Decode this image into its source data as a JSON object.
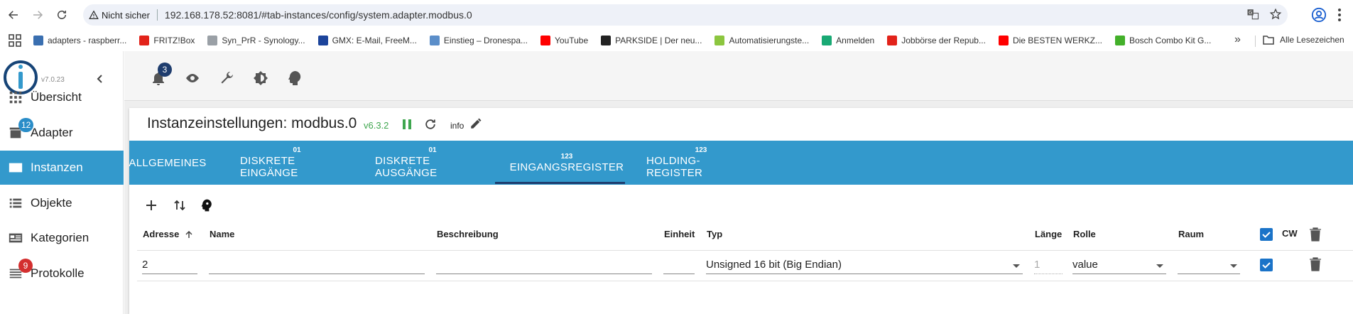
{
  "browser": {
    "security_label": "Nicht sicher",
    "url": "192.168.178.52:8081/#tab-instances/config/system.adapter.modbus.0",
    "bookmarks": [
      {
        "label": "adapters - raspberr...",
        "color": "#3a6fb0"
      },
      {
        "label": "FRITZ!Box",
        "color": "#e2231a"
      },
      {
        "label": "Syn_PrR - Synology...",
        "color": "#9aa0a6"
      },
      {
        "label": "GMX: E-Mail, FreeM...",
        "color": "#1c449b"
      },
      {
        "label": "Einstieg – Dronespa...",
        "color": "#5b8ec9"
      },
      {
        "label": "YouTube",
        "color": "#ff0000"
      },
      {
        "label": "PARKSIDE | Der neu...",
        "color": "#222222"
      },
      {
        "label": "Automatisierungste...",
        "color": "#8cc63f"
      },
      {
        "label": "Anmelden",
        "color": "#19a974"
      },
      {
        "label": "Jobbörse der Repub...",
        "color": "#e2231a"
      },
      {
        "label": "Die BESTEN WERKZ...",
        "color": "#ff0000"
      },
      {
        "label": "Bosch Combo Kit G...",
        "color": "#43b02a"
      }
    ],
    "all_bookmarks": "Alle Lesezeichen"
  },
  "app": {
    "version": "v7.0.23",
    "nav": [
      {
        "label": "Übersicht",
        "icon": "grid-icon",
        "badge": ""
      },
      {
        "label": "Adapter",
        "icon": "store-icon",
        "badge": "12"
      },
      {
        "label": "Instanzen",
        "icon": "instances-icon",
        "badge": ""
      },
      {
        "label": "Objekte",
        "icon": "list-icon",
        "badge": ""
      },
      {
        "label": "Kategorien",
        "icon": "categories-icon",
        "badge": ""
      },
      {
        "label": "Protokolle",
        "icon": "log-icon",
        "badge": "9"
      }
    ],
    "notification_count": "3",
    "colors": {
      "accent": "#3399cc",
      "dark_badge": "#1f3d6e",
      "adapter_badge": "#2a8dc8",
      "log_badge": "#d32f2f",
      "checkbox": "#1a73c8",
      "version_green": "#3fa64f"
    }
  },
  "panel": {
    "title": "Instanzeinstellungen: modbus.0",
    "version": "v6.3.2",
    "info": "info",
    "tabs": [
      {
        "label": "ALLGEMEINES",
        "sup": ""
      },
      {
        "label": "DISKRETE EINGÄNGE",
        "sup": "01"
      },
      {
        "label": "DISKRETE AUSGÄNGE",
        "sup": "01"
      },
      {
        "label": "EINGANGSREGISTER",
        "sup": "123"
      },
      {
        "label": "HOLDING-REGISTER",
        "sup": "123"
      }
    ],
    "table": {
      "headers": {
        "adresse": "Adresse",
        "name": "Name",
        "beschreibung": "Beschreibung",
        "einheit": "Einheit",
        "typ": "Typ",
        "laenge": "Länge",
        "rolle": "Rolle",
        "raum": "Raum",
        "cw": "CW"
      },
      "rows": [
        {
          "adresse": "2",
          "name": "",
          "beschreibung": "",
          "einheit": "",
          "typ": "Unsigned 16 bit (Big Endian)",
          "laenge": "1",
          "rolle": "value",
          "raum": "",
          "checked": true
        }
      ]
    }
  }
}
